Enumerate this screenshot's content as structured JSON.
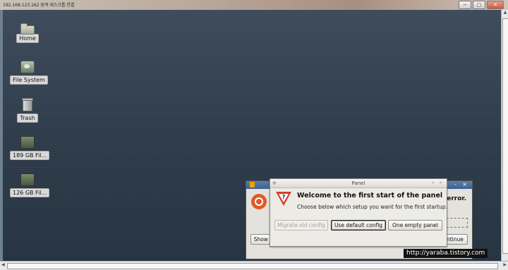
{
  "window": {
    "title": "192.168.123.162 원격 데스크톱 연결",
    "minimize": "−",
    "maximize": "▢",
    "close": "✕"
  },
  "desktop_icons": [
    {
      "label": "Home",
      "icon": "home-folder-icon"
    },
    {
      "label": "File System",
      "icon": "drive-icon"
    },
    {
      "label": "Trash",
      "icon": "trash-icon"
    },
    {
      "label": "189 GB Fil...",
      "icon": "hard-disk-icon"
    },
    {
      "label": "126 GB Fil...",
      "icon": "hard-disk-icon"
    }
  ],
  "background_dialog": {
    "title_controls": "+ - ×",
    "error_text": "error.",
    "show_details": "Show Details",
    "continue": "Continue"
  },
  "panel_dialog": {
    "title": "Panel",
    "title_controls": "+ ×",
    "heading": "Welcome to the first start of the panel",
    "subtext": "Choose below which setup you want for the first startup.",
    "buttons": {
      "migrate": "Migrate old config",
      "default": "Use default config",
      "empty": "One empty panel"
    }
  },
  "watermark": "http://yaraba.tistory.com",
  "colors": {
    "desktop": "#2e3b4a",
    "warning_red": "#d93a2a",
    "ubuntu_orange": "#e05a26"
  }
}
